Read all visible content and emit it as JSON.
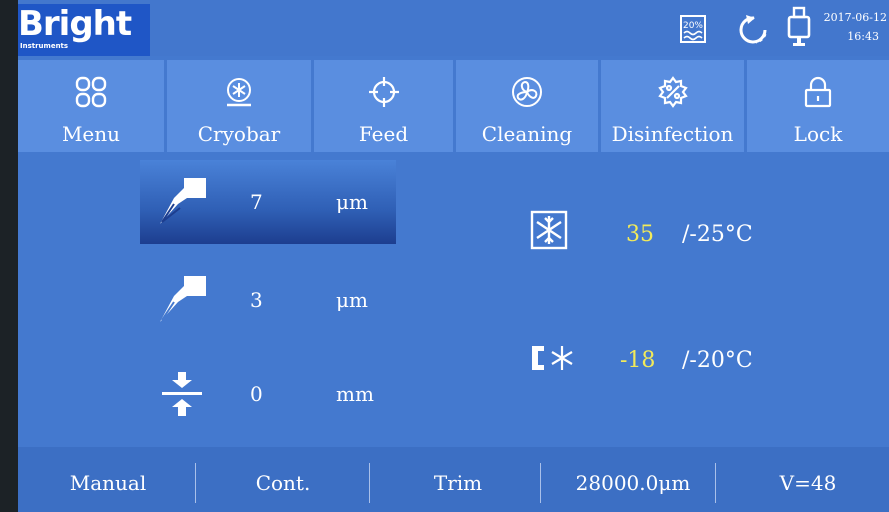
{
  "brand": {
    "name": "Bright",
    "sub": "Instruments"
  },
  "header": {
    "storage_level": "20%",
    "date": "2017-06-12",
    "time": "16:43",
    "icons": [
      "storage-level-icon",
      "refresh-icon",
      "usb-icon"
    ]
  },
  "toolbar": [
    {
      "label": "Menu",
      "icon": "menu-grid-icon"
    },
    {
      "label": "Cryobar",
      "icon": "cryobar-icon"
    },
    {
      "label": "Feed",
      "icon": "crosshair-icon"
    },
    {
      "label": "Cleaning",
      "icon": "fan-icon"
    },
    {
      "label": "Disinfection",
      "icon": "disinfection-icon"
    },
    {
      "label": "Lock",
      "icon": "lock-icon"
    }
  ],
  "sections": [
    {
      "value": "7",
      "unit": "μm",
      "icon": "section-thickness-icon",
      "selected": true
    },
    {
      "value": "3",
      "unit": "μm",
      "icon": "trim-thickness-icon",
      "selected": false
    },
    {
      "value": "0",
      "unit": "mm",
      "icon": "retraction-icon",
      "selected": false
    }
  ],
  "temperatures": {
    "chamber": {
      "current": "35",
      "target": "/-25°C",
      "icon": "snowflake-chamber-icon"
    },
    "specimen": {
      "current": "-18",
      "target": "/-20°C",
      "icon": "specimen-cooling-icon"
    }
  },
  "status": {
    "mode": "Manual",
    "cut": "Cont.",
    "trim": "Trim",
    "position": "28000.0μm",
    "speed": "V=48"
  },
  "colors": {
    "screen_bg": "#4479cf",
    "button_bg": "#5a8ee0",
    "current_temp": "#f2ea5a",
    "text": "#ffffff"
  }
}
